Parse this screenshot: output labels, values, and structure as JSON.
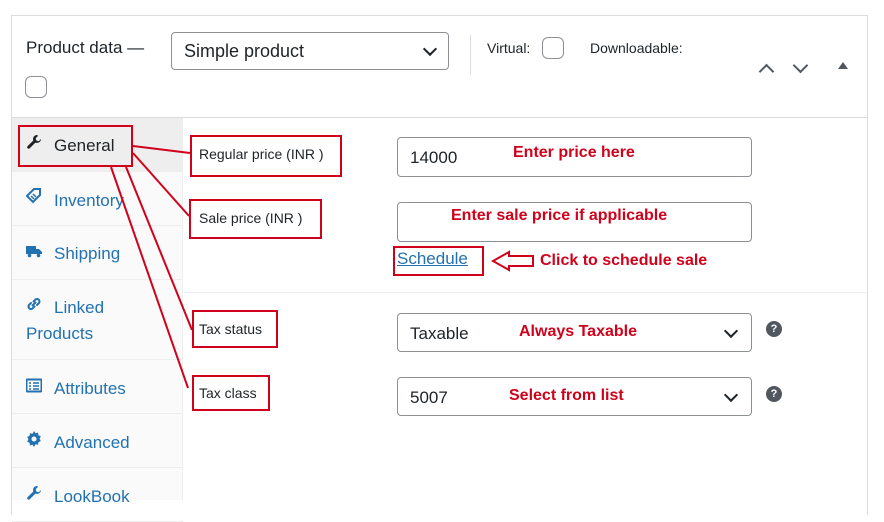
{
  "header": {
    "title": "Product data —",
    "product_type": "Simple product",
    "virtual_label": "Virtual:",
    "downloadable_label": "Downloadable:"
  },
  "sidebar": {
    "items": [
      {
        "label": "General",
        "icon": "wrench-icon"
      },
      {
        "label": "Inventory",
        "icon": "tag-icon"
      },
      {
        "label": "Shipping",
        "icon": "truck-icon"
      },
      {
        "label": "Linked",
        "label2": "Products",
        "icon": "link-icon"
      },
      {
        "label": "Attributes",
        "icon": "list-icon"
      },
      {
        "label": "Advanced",
        "icon": "gear-icon"
      },
      {
        "label": "LookBook",
        "icon": "wrench-icon"
      }
    ]
  },
  "fields": {
    "regular_price_label": "Regular price (INR )",
    "regular_price_value": "14000",
    "sale_price_label": "Sale price (INR )",
    "sale_price_value": "",
    "schedule_link": "Schedule",
    "tax_status_label": "Tax status",
    "tax_status_value": "Taxable",
    "tax_class_label": "Tax class",
    "tax_class_value": "5007"
  },
  "annotations": {
    "enter_price": "Enter price here",
    "enter_sale": "Enter sale price if applicable",
    "schedule_sale": "Click to schedule sale",
    "always_taxable": "Always Taxable",
    "select_list": "Select from list"
  },
  "colors": {
    "link": "#2271b1",
    "annotation": "#d0021b"
  }
}
